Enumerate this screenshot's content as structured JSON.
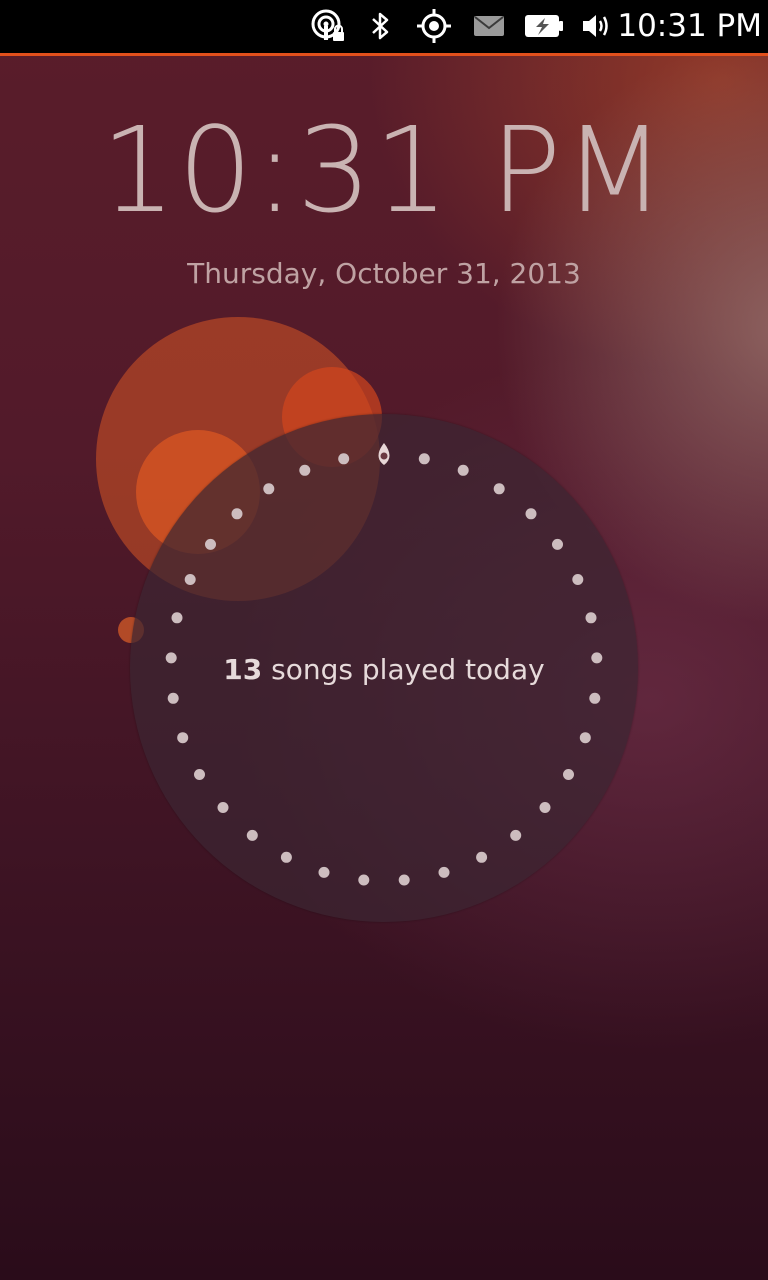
{
  "status_bar": {
    "time": "10:31 PM",
    "indicators": [
      "network-icon",
      "bluetooth-icon",
      "location-icon",
      "messages-icon",
      "battery-icon",
      "sound-icon"
    ]
  },
  "greeter": {
    "time": "10:31 PM",
    "date": "Thursday, October 31, 2013",
    "stat_count": "13",
    "stat_text": " songs played today",
    "dots_total": 33,
    "dots_lit": 32
  },
  "colors": {
    "accent": "#e2501c",
    "bubble": "#d65624",
    "text": "#c9b3b2"
  }
}
